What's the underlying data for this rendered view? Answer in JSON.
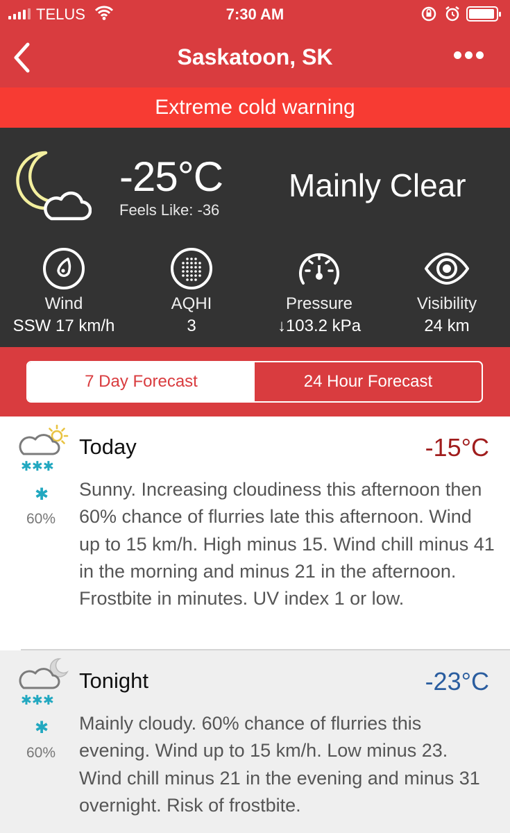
{
  "status_bar": {
    "carrier": "TELUS",
    "time": "7:30 AM"
  },
  "nav": {
    "title": "Saskatoon, SK"
  },
  "alert": {
    "text": "Extreme cold warning"
  },
  "current": {
    "temperature": "-25°C",
    "feels_like": "Feels Like: -36",
    "condition": "Mainly Clear",
    "stats": [
      {
        "label": "Wind",
        "value": "SSW 17 km/h",
        "icon": "wind-compass-icon"
      },
      {
        "label": "AQHI",
        "value": "3",
        "icon": "aqhi-dots-icon"
      },
      {
        "label": "Pressure",
        "value": "↓103.2 kPa",
        "icon": "pressure-gauge-icon"
      },
      {
        "label": "Visibility",
        "value": "24 km",
        "icon": "eye-icon"
      }
    ]
  },
  "tabs": [
    {
      "label": "7 Day Forecast",
      "active": true
    },
    {
      "label": "24 Hour Forecast",
      "active": false
    }
  ],
  "forecast": [
    {
      "period": "Today",
      "high": "-15°C",
      "temp_color": "#a01d1d",
      "pop": "60%",
      "icon": "cloud-sun-snow-icon",
      "description": "Sunny. Increasing cloudiness this afternoon then 60% chance of flurries late this afternoon. Wind up to 15 km/h. High minus 15. Wind chill minus 41 in the morning and minus 21 in the afternoon. Frostbite in minutes. UV index 1 or low."
    },
    {
      "period": "Tonight",
      "high": "-23°C",
      "temp_color": "#2a5d9f",
      "pop": "60%",
      "icon": "cloud-moon-snow-icon",
      "description": "Mainly cloudy. 60% chance of flurries this evening. Wind up to 15 km/h. Low minus 23. Wind chill minus 21 in the evening and minus 31 overnight. Risk of frostbite."
    }
  ],
  "colors": {
    "header_red": "#d93c3f",
    "alert_red": "#f73b33",
    "panel_dark": "#333333",
    "snow_teal": "#22a8c0"
  }
}
